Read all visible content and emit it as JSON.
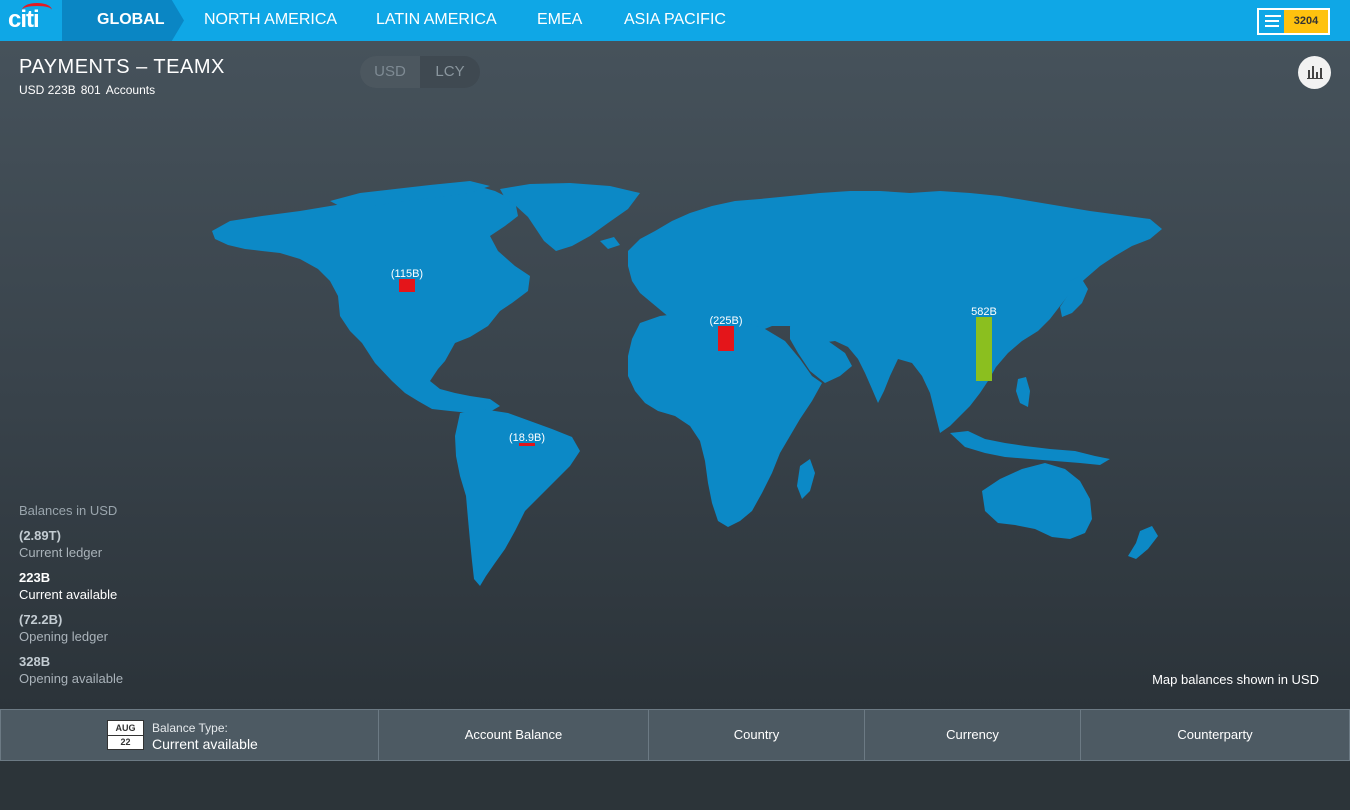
{
  "brand": {
    "logo_text": "citi"
  },
  "nav": {
    "items": [
      "GLOBAL",
      "NORTH AMERICA",
      "LATIN AMERICA",
      "EMEA",
      "ASIA PACIFIC"
    ],
    "active": "GLOBAL"
  },
  "notifications": {
    "icon": "menu-icon",
    "count": "3204"
  },
  "header": {
    "title": "PAYMENTS – TEAMX",
    "currency_amount": "USD 223B",
    "accounts_count": "801",
    "accounts_label": "Accounts"
  },
  "currency_toggle": {
    "options": [
      "USD",
      "LCY"
    ],
    "selected": "USD"
  },
  "chart_button": {
    "icon": "bar-chart-icon"
  },
  "map": {
    "markers": [
      {
        "region": "North America",
        "label": "(115B)",
        "value_billion": -115,
        "color": "#e4151a"
      },
      {
        "region": "EMEA",
        "label": "(225B)",
        "value_billion": -225,
        "color": "#e4151a"
      },
      {
        "region": "Asia Pacific",
        "label": "582B",
        "value_billion": 582,
        "color": "#8bbf1f"
      },
      {
        "region": "Latin America",
        "label": "(18.9B)",
        "value_billion": -18.9,
        "color": "#e4151a"
      }
    ],
    "land_color": "#0c89c6",
    "note": "Map balances shown in USD"
  },
  "balances": {
    "heading": "Balances in USD",
    "items": [
      {
        "value": "(2.89T)",
        "label": "Current ledger"
      },
      {
        "value": "223B",
        "label": "Current available",
        "highlight": true
      },
      {
        "value": "(72.2B)",
        "label": "Opening ledger"
      },
      {
        "value": "328B",
        "label": "Opening available"
      }
    ]
  },
  "bottom_tabs": {
    "date": {
      "month": "AUG",
      "day": "22"
    },
    "balance_type_label": "Balance Type:",
    "balance_type_value": "Current available",
    "tabs": [
      "Account Balance",
      "Country",
      "Currency",
      "Counterparty"
    ]
  }
}
